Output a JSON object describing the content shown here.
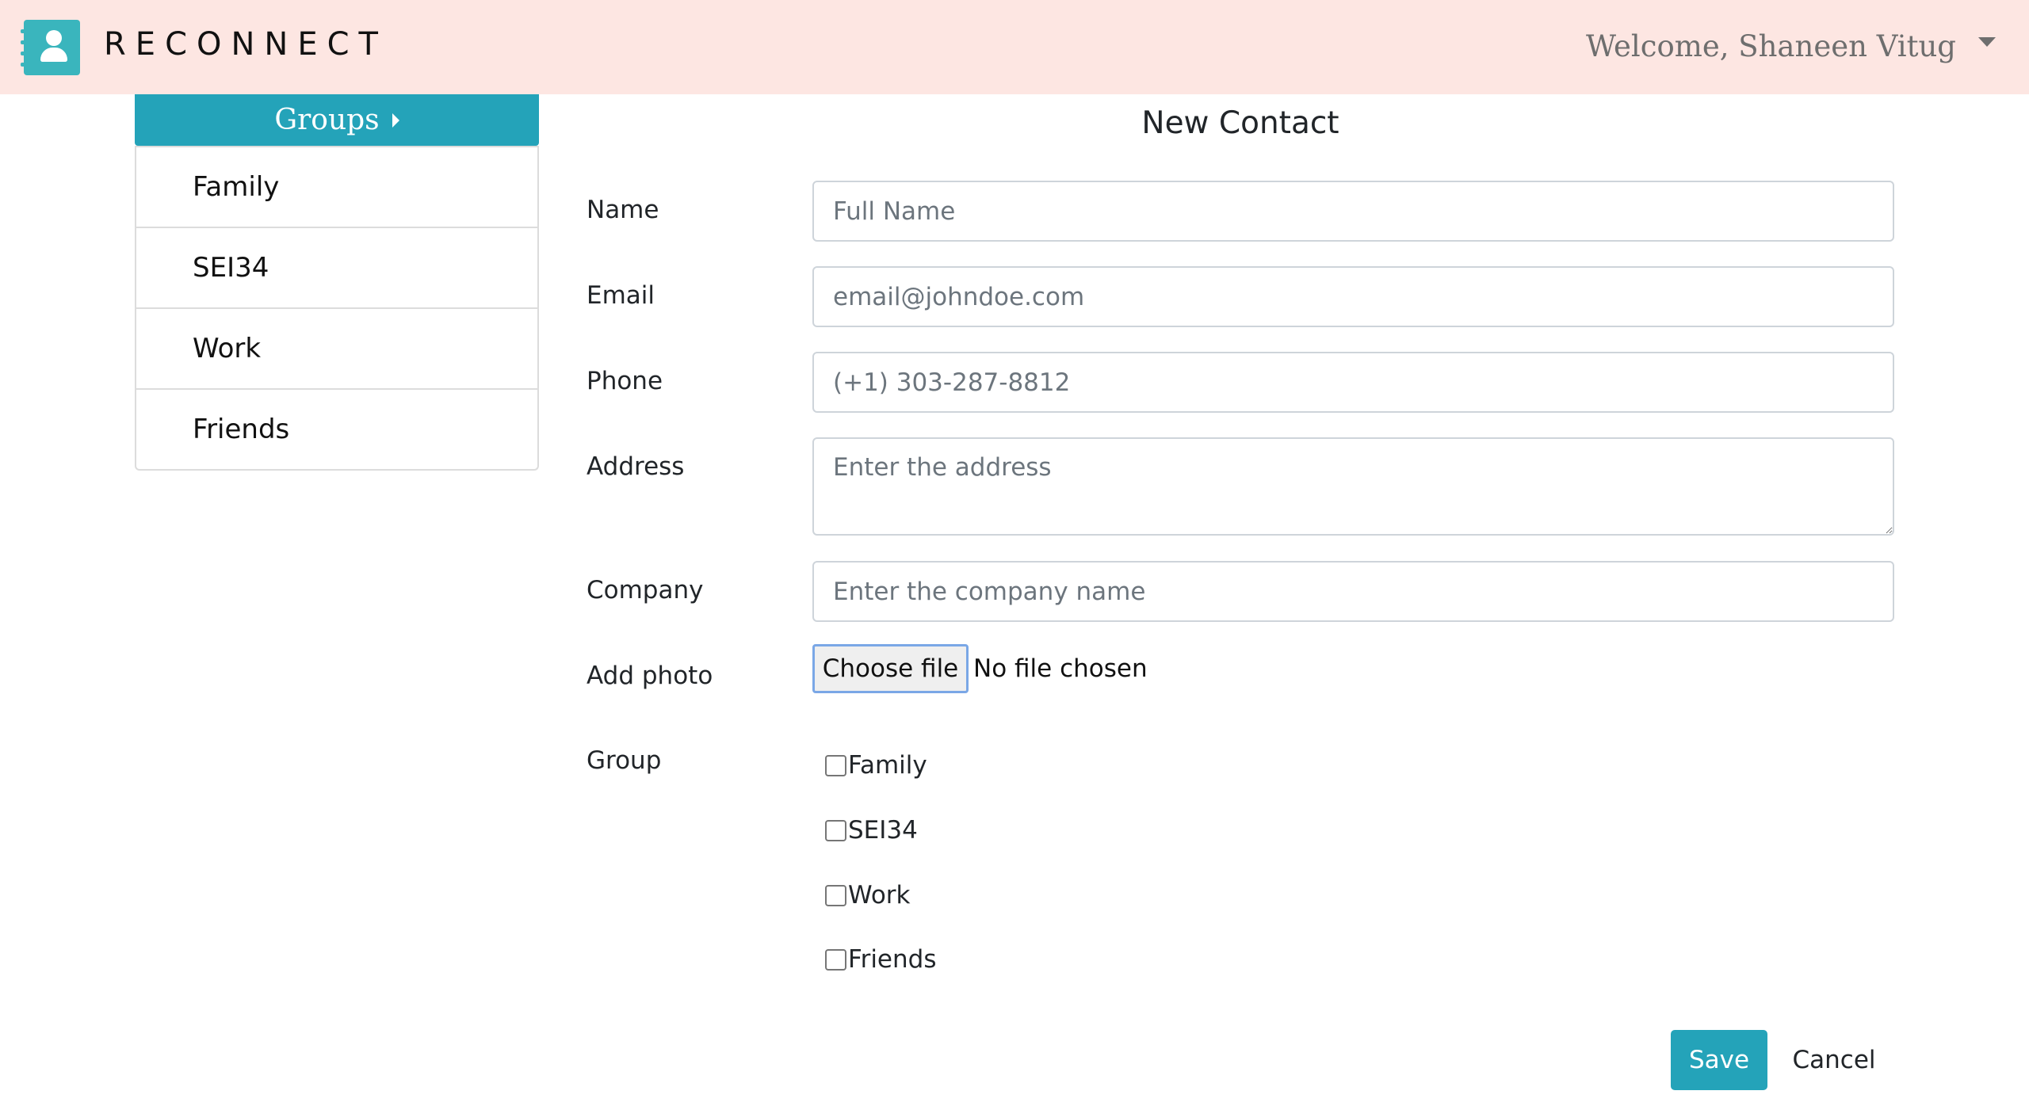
{
  "navbar": {
    "brand": "RECONNECT",
    "welcome": "Welcome, Shaneen Vitug",
    "logo_icon": "address-book-icon",
    "accent_color": "#3ab5bd",
    "background_color": "#fde6e2"
  },
  "sidebar": {
    "header": "Groups",
    "header_color": "#24a3b9",
    "items": [
      {
        "label": "Family"
      },
      {
        "label": "SEI34"
      },
      {
        "label": "Work"
      },
      {
        "label": "Friends"
      }
    ]
  },
  "form": {
    "title": "New Contact",
    "name": {
      "label": "Name",
      "placeholder": "Full Name",
      "value": ""
    },
    "email": {
      "label": "Email",
      "placeholder": "email@johndoe.com",
      "value": ""
    },
    "phone": {
      "label": "Phone",
      "placeholder": "(+1) 303-287-8812",
      "value": ""
    },
    "address": {
      "label": "Address",
      "placeholder": "Enter the address",
      "value": ""
    },
    "company": {
      "label": "Company",
      "placeholder": "Enter the company name",
      "value": ""
    },
    "photo": {
      "label": "Add photo",
      "button": "Choose file",
      "status": "No file chosen"
    },
    "group": {
      "label": "Group",
      "options": [
        {
          "label": "Family",
          "checked": false
        },
        {
          "label": "SEI34",
          "checked": false
        },
        {
          "label": "Work",
          "checked": false
        },
        {
          "label": "Friends",
          "checked": false
        }
      ]
    },
    "save_label": "Save",
    "cancel_label": "Cancel"
  }
}
